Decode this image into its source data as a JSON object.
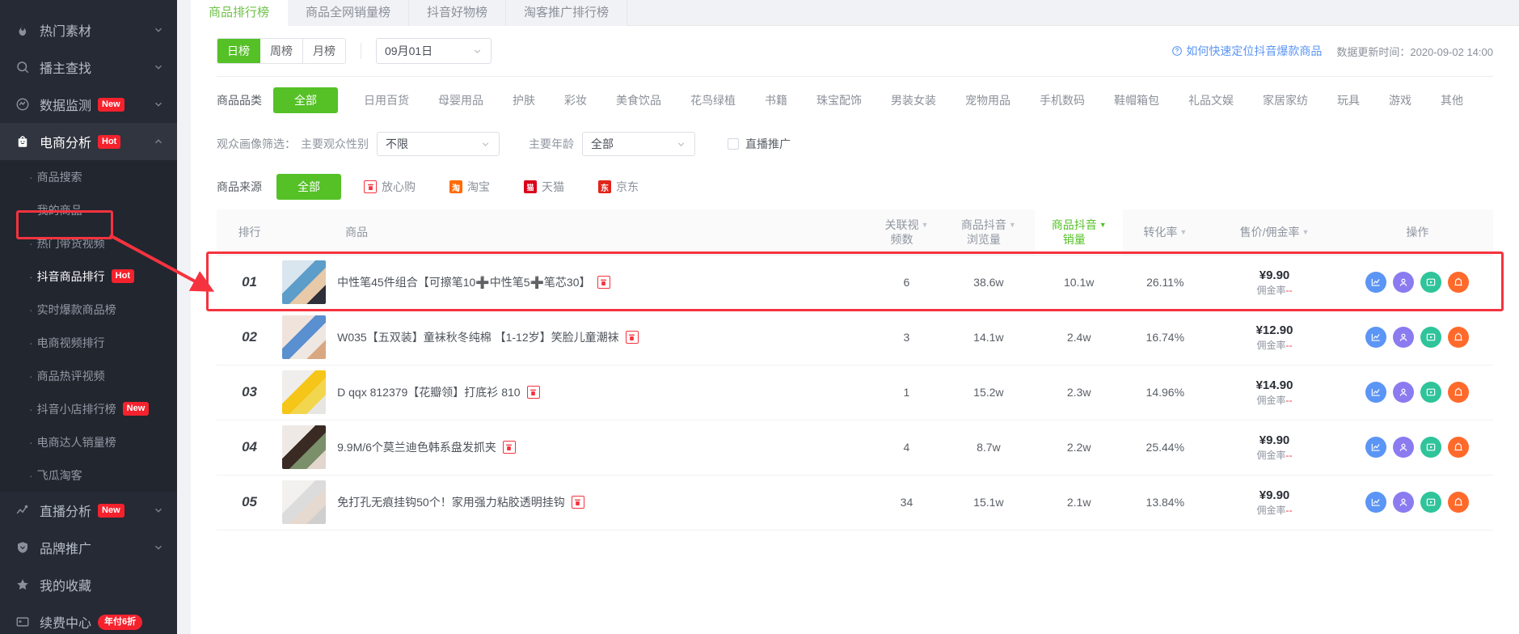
{
  "sidebar": {
    "items": [
      {
        "label": "热门素材",
        "icon": "fire-icon",
        "badge": "",
        "expandable": true,
        "active": false
      },
      {
        "label": "播主查找",
        "icon": "search-icon",
        "badge": "",
        "expandable": true,
        "active": false
      },
      {
        "label": "数据监测",
        "icon": "monitor-icon",
        "badge": "New",
        "expandable": true,
        "active": false
      },
      {
        "label": "电商分析",
        "icon": "bag-icon",
        "badge": "Hot",
        "expandable": true,
        "active": true
      }
    ],
    "sub_items": [
      {
        "label": "商品搜索",
        "badge": "",
        "selected": false
      },
      {
        "label": "我的商品",
        "badge": "",
        "selected": false
      },
      {
        "label": "热门带货视频",
        "badge": "",
        "selected": false
      },
      {
        "label": "抖音商品排行",
        "badge": "Hot",
        "selected": true
      },
      {
        "label": "实时爆款商品榜",
        "badge": "",
        "selected": false
      },
      {
        "label": "电商视频排行",
        "badge": "",
        "selected": false
      },
      {
        "label": "商品热评视频",
        "badge": "",
        "selected": false
      },
      {
        "label": "抖音小店排行榜",
        "badge": "New",
        "selected": false
      },
      {
        "label": "电商达人销量榜",
        "badge": "",
        "selected": false
      },
      {
        "label": "飞瓜淘客",
        "badge": "",
        "selected": false
      }
    ],
    "bottom_items": [
      {
        "label": "直播分析",
        "icon": "chart-line-icon",
        "badge": "New",
        "expandable": true
      },
      {
        "label": "品牌推广",
        "icon": "shield-icon",
        "badge": "",
        "expandable": true
      },
      {
        "label": "我的收藏",
        "icon": "star-icon",
        "badge": "",
        "expandable": false
      },
      {
        "label": "续费中心",
        "icon": "card-icon",
        "badge": "年付6折",
        "expandable": false
      }
    ]
  },
  "tabs": [
    {
      "label": "商品排行榜",
      "active": true
    },
    {
      "label": "商品全网销量榜",
      "active": false
    },
    {
      "label": "抖音好物榜",
      "active": false
    },
    {
      "label": "淘客推广排行榜",
      "active": false
    }
  ],
  "toolbar": {
    "periods": [
      {
        "label": "日榜",
        "active": true
      },
      {
        "label": "周榜",
        "active": false
      },
      {
        "label": "月榜",
        "active": false
      }
    ],
    "date_value": "09月01日",
    "help_link": "如何快速定位抖音爆款商品",
    "help_icon": "question-circle-icon",
    "update_time": "数据更新时间：2020-09-02 14:00"
  },
  "category_filter": {
    "label": "商品品类",
    "items": [
      {
        "label": "全部",
        "active": true
      },
      {
        "label": "日用百货",
        "active": false
      },
      {
        "label": "母婴用品",
        "active": false
      },
      {
        "label": "护肤",
        "active": false
      },
      {
        "label": "彩妆",
        "active": false
      },
      {
        "label": "美食饮品",
        "active": false
      },
      {
        "label": "花鸟绿植",
        "active": false
      },
      {
        "label": "书籍",
        "active": false
      },
      {
        "label": "珠宝配饰",
        "active": false
      },
      {
        "label": "男装女装",
        "active": false
      },
      {
        "label": "宠物用品",
        "active": false
      },
      {
        "label": "手机数码",
        "active": false
      },
      {
        "label": "鞋帽箱包",
        "active": false
      },
      {
        "label": "礼品文娱",
        "active": false
      },
      {
        "label": "家居家纺",
        "active": false
      },
      {
        "label": "玩具",
        "active": false
      },
      {
        "label": "游戏",
        "active": false
      },
      {
        "label": "其他",
        "active": false
      }
    ]
  },
  "audience_filter": {
    "label": "观众画像筛选：",
    "gender_label": "主要观众性别",
    "gender_value": "不限",
    "age_label": "主要年龄",
    "age_value": "全部",
    "live_promo_label": "直播推广",
    "live_promo_checked": false
  },
  "source_filter": {
    "label": "商品来源",
    "items": [
      {
        "label": "全部",
        "active": true,
        "icon": ""
      },
      {
        "label": "放心购",
        "active": false,
        "icon": "fangxingou-icon",
        "color": "#f5333f"
      },
      {
        "label": "淘宝",
        "active": false,
        "icon": "taobao-icon",
        "color": "#ff6a00"
      },
      {
        "label": "天猫",
        "active": false,
        "icon": "tmall-icon",
        "color": "#d9001b"
      },
      {
        "label": "京东",
        "active": false,
        "icon": "jd-icon",
        "color": "#e1251b"
      }
    ]
  },
  "table": {
    "columns": [
      {
        "label": "排行",
        "sortable": false,
        "highlight": false
      },
      {
        "label": "商品",
        "sortable": false,
        "highlight": false
      },
      {
        "label": "关联视\n频数",
        "sortable": true,
        "highlight": false
      },
      {
        "label": "商品抖音\n浏览量",
        "sortable": true,
        "highlight": false
      },
      {
        "label": "商品抖音\n销量",
        "sortable": true,
        "highlight": true
      },
      {
        "label": "转化率",
        "sortable": true,
        "highlight": false
      },
      {
        "label": "售价/佣金率",
        "sortable": true,
        "highlight": false
      },
      {
        "label": "操作",
        "sortable": false,
        "highlight": false
      }
    ],
    "commission_label": "佣金率",
    "commission_value": "--",
    "rows": [
      {
        "rank": "01",
        "name": "中性笔45件组合【可擦笔10➕中性笔5➕笔芯30】",
        "tag": "fangxingou-icon",
        "videos": "6",
        "views": "38.6w",
        "sales": "10.1w",
        "conversion": "26.11%",
        "price": "¥9.90",
        "highlighted": true,
        "thumb_colors": [
          "#d9e5ef",
          "#5c9ec9",
          "#e8c9a8",
          "#2f2f3a"
        ]
      },
      {
        "rank": "02",
        "name": "W035【五双装】童袜秋冬纯棉 【1-12岁】笑脸儿童潮袜",
        "tag": "fangxingou-icon",
        "videos": "3",
        "views": "14.1w",
        "sales": "2.4w",
        "conversion": "16.74%",
        "price": "¥12.90",
        "highlighted": false,
        "thumb_colors": [
          "#f0e3dc",
          "#5a8fd0",
          "#efe7e1",
          "#d8a882"
        ]
      },
      {
        "rank": "03",
        "name": "D qqx 812379【花瓣领】打底衫 810",
        "tag": "fangxingou-icon",
        "videos": "1",
        "views": "15.2w",
        "sales": "2.3w",
        "conversion": "14.96%",
        "price": "¥14.90",
        "highlighted": false,
        "thumb_colors": [
          "#efeeec",
          "#f5c518",
          "#f2d64e",
          "#e8e6e2"
        ]
      },
      {
        "rank": "04",
        "name": "9.9M/6个莫兰迪色韩系盘发抓夹",
        "tag": "fangxingou-icon",
        "videos": "4",
        "views": "8.7w",
        "sales": "2.2w",
        "conversion": "25.44%",
        "price": "¥9.90",
        "highlighted": false,
        "thumb_colors": [
          "#efe9e6",
          "#3a2a24",
          "#7b8f6a",
          "#e3d6cd"
        ]
      },
      {
        "rank": "05",
        "name": "免打孔无痕挂钩50个！家用强力粘胶透明挂钩",
        "tag": "fangxingou-icon",
        "videos": "34",
        "views": "15.1w",
        "sales": "2.1w",
        "conversion": "13.84%",
        "price": "¥9.90",
        "highlighted": false,
        "thumb_colors": [
          "#f2f1ef",
          "#dcdcdc",
          "#e6d9cf",
          "#cfcfcf"
        ]
      }
    ],
    "ops": [
      {
        "name": "trend-chart-icon",
        "color": "#5b95f5"
      },
      {
        "name": "person-icon",
        "color": "#8b7bf0"
      },
      {
        "name": "video-play-icon",
        "color": "#2fc49a"
      },
      {
        "name": "alert-icon",
        "color": "#ff6a2b"
      }
    ]
  },
  "colors": {
    "accent_green": "#55c127",
    "accent_red": "#f5333f",
    "link_blue": "#5b95f5",
    "sidebar_bg": "#252a35"
  }
}
